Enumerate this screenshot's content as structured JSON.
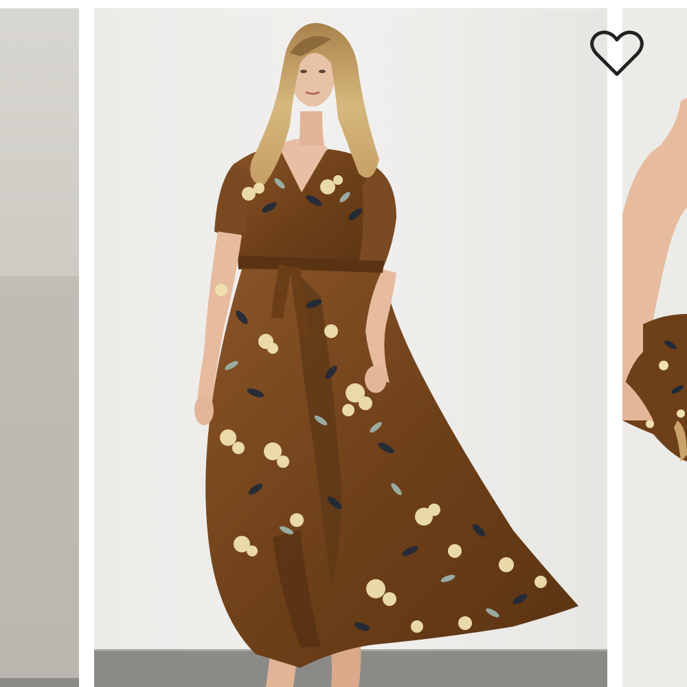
{
  "carousel": {
    "slides": [
      {
        "id": "prev",
        "position": "previous",
        "alt": ""
      },
      {
        "id": "main",
        "position": "current",
        "alt": ""
      },
      {
        "id": "next",
        "position": "next",
        "alt": ""
      }
    ],
    "wishlist": {
      "icon": "heart-outline-icon",
      "state": "not-saved"
    }
  },
  "colors": {
    "wall": "#eeeeec",
    "floor": "#8a8a88",
    "dress": "#7a4a22",
    "dress_dark": "#4e2e14",
    "floral_cream": "#f1e2b0",
    "floral_navy": "#1f2a3a",
    "floral_sage": "#9fb8b0",
    "skin": "#e8bfa4",
    "hair": "#c8a46a",
    "heart_stroke": "#222222"
  }
}
